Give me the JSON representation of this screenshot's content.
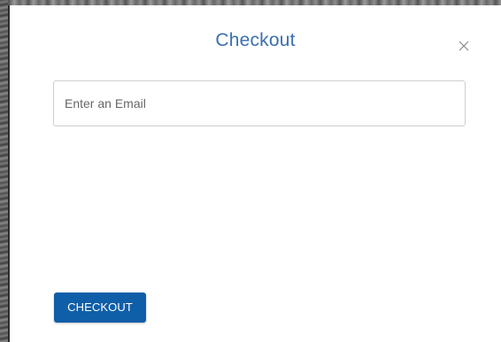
{
  "modal": {
    "title": "Checkout",
    "close_icon": "close-icon",
    "email": {
      "placeholder": "Enter an Email",
      "value": ""
    },
    "checkout_label": "CHECKOUT"
  },
  "colors": {
    "title": "#3a6fb0",
    "button_background": "#0f5ea8",
    "button_text": "#ffffff",
    "input_border": "#cfcfcf"
  }
}
